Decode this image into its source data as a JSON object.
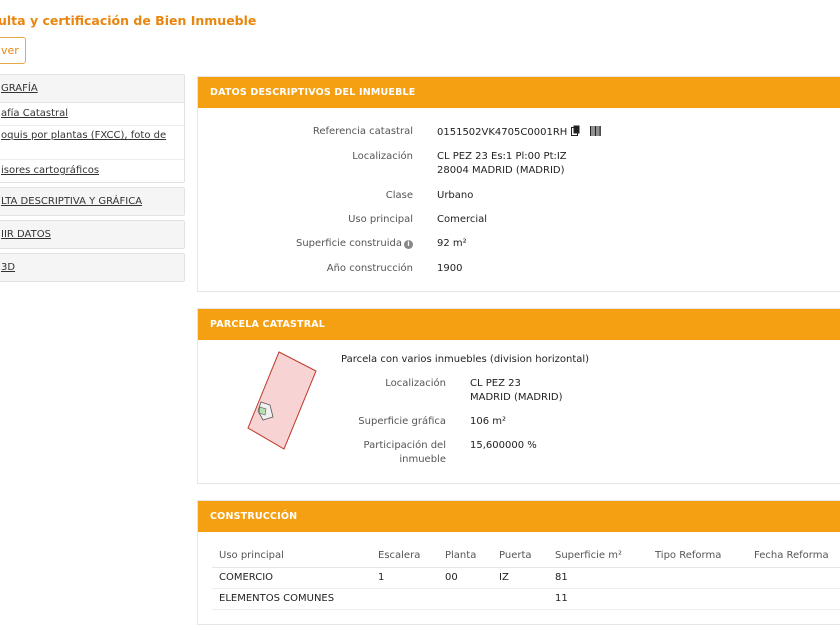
{
  "page": {
    "title": "ulta y certificación de Bien Inmueble",
    "back_label": "ver"
  },
  "sidebar": {
    "cartografia": {
      "header": "GRAFÍA",
      "items": [
        "afía Catastral",
        "oquis por plantas (FXCC), foto de",
        "isores cartográficos"
      ]
    },
    "consulta": "LTA DESCRIPTIVA Y GRÁFICA",
    "imprimir": "IIR DATOS",
    "vista3d": "3D"
  },
  "datos": {
    "header": "DATOS DESCRIPTIVOS DEL INMUEBLE",
    "ref_label": "Referencia catastral",
    "ref_value": "0151502VK4705C0001RH",
    "loc_label": "Localización",
    "loc_line1": "CL PEZ 23 Es:1 Pl:00 Pt:IZ",
    "loc_line2": "28004 MADRID (MADRID)",
    "clase_label": "Clase",
    "clase_value": "Urbano",
    "uso_label": "Uso principal",
    "uso_value": "Comercial",
    "sup_label": "Superficie construida",
    "sup_value": "92 m²",
    "anio_label": "Año construcción",
    "anio_value": "1900"
  },
  "parcela": {
    "header": "PARCELA CATASTRAL",
    "desc": "Parcela con varios inmuebles (division horizontal)",
    "loc_label": "Localización",
    "loc_line1": "CL PEZ 23",
    "loc_line2": "MADRID (MADRID)",
    "sup_label": "Superficie gráfica",
    "sup_value": "106 m²",
    "part_label_1": "Participación del",
    "part_label_2": "inmueble",
    "part_value": "15,600000 %"
  },
  "construccion": {
    "header": "CONSTRUCCIÓN",
    "columns": [
      "Uso principal",
      "Escalera",
      "Planta",
      "Puerta",
      "Superficie m²",
      "Tipo Reforma",
      "Fecha Reforma"
    ],
    "rows": [
      [
        "COMERCIO",
        "1",
        "00",
        "IZ",
        "81",
        "",
        ""
      ],
      [
        "ELEMENTOS COMUNES",
        "",
        "",
        "",
        "11",
        "",
        ""
      ]
    ]
  },
  "colors": {
    "accent": "#f5a012",
    "title": "#e8860f",
    "parcel_fill": "#f7d3d3",
    "parcel_stroke": "#c0392b"
  },
  "icons": [
    "info-icon",
    "copy-icon",
    "barcode-icon"
  ]
}
